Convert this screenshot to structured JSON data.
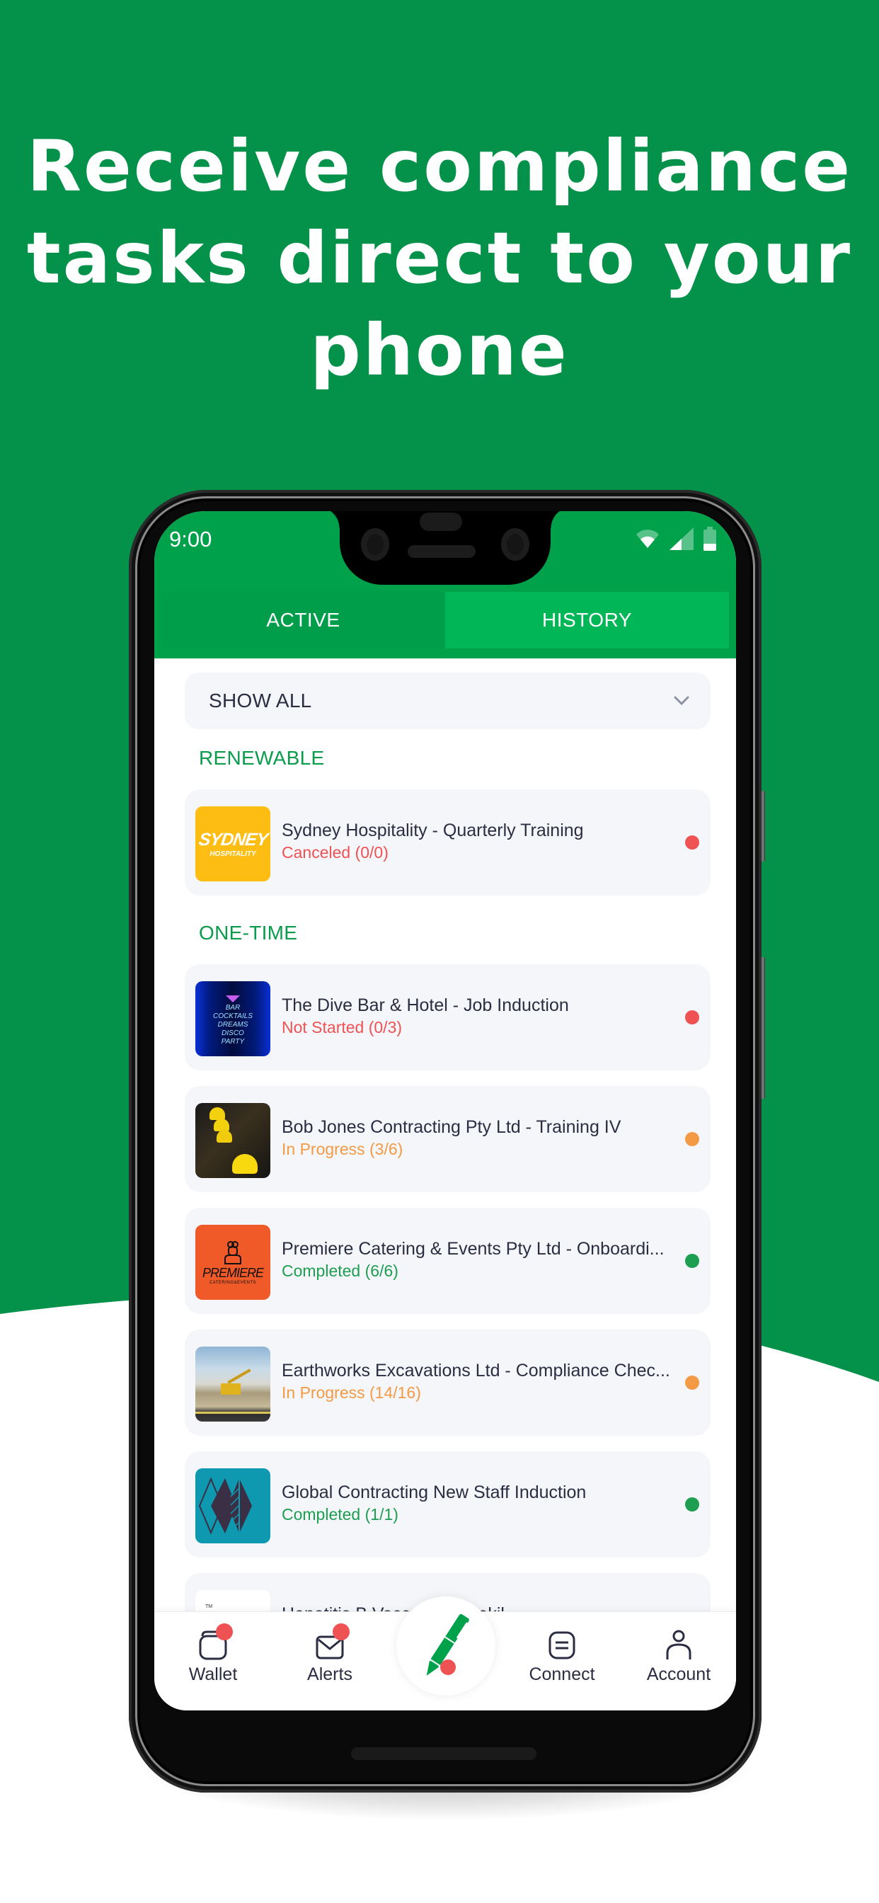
{
  "headline": {
    "lines": [
      "Receive compliance",
      "tasks direct to your",
      "phone"
    ]
  },
  "colors": {
    "brand_green": "#049149",
    "status_green": "#00A14B",
    "tab_active": "#009E4A",
    "tab_inactive": "#00B656",
    "section_green": "#0A9B4C",
    "red": "#EE5253",
    "orange": "#F39A45",
    "green_status": "#1E9E50",
    "text_dark": "#2B2D42"
  },
  "status_bar": {
    "time": "9:00",
    "icons": [
      "wifi-icon",
      "signal-icon",
      "battery-icon"
    ]
  },
  "tabs": [
    {
      "label": "ACTIVE",
      "selected": true
    },
    {
      "label": "HISTORY",
      "selected": false
    }
  ],
  "filter": {
    "selected": "SHOW ALL",
    "icon": "chevron-down-icon"
  },
  "sections": [
    {
      "label": "RENEWABLE",
      "items": [
        {
          "title": "Sydney Hospitality - Quarterly Training",
          "status": "Canceled (0/0)",
          "status_type": "red",
          "thumb": "sydney-hospitality-logo",
          "thumb_text": [
            "SYDNEY",
            "HOSPITALITY"
          ]
        }
      ]
    },
    {
      "label": "ONE-TIME",
      "items": [
        {
          "title": "The Dive Bar & Hotel - Job Induction",
          "status": "Not Started (0/3)",
          "status_type": "red",
          "thumb": "neon-bar-sign-photo",
          "thumb_text": [
            "BAR",
            "COCKTAILS",
            "DREAMS",
            "DISCO",
            "PARTY"
          ]
        },
        {
          "title": "Bob Jones Contracting Pty Ltd - Training IV",
          "status": "In Progress (3/6)",
          "status_type": "orange",
          "thumb": "hard-hats-photo"
        },
        {
          "title": "Premiere Catering & Events Pty Ltd - Onboardi...",
          "status": "Completed (6/6)",
          "status_type": "green",
          "thumb": "premiere-catering-logo",
          "thumb_text": [
            "PREMIERE",
            "CATERING&EVENTS"
          ]
        },
        {
          "title": "Earthworks Excavations Ltd - Compliance Chec...",
          "status": "In Progress (14/16)",
          "status_type": "orange",
          "thumb": "excavator-photo"
        },
        {
          "title": "Global Contracting New Staff Induction",
          "status": "Completed (1/1)",
          "status_type": "green",
          "thumb": "global-contracting-logo"
        },
        {
          "title": "Hepatitis B Vacc... - Rentokil",
          "status": "",
          "status_type": "",
          "thumb": "tm-logo",
          "thumb_text": [
            "TM"
          ],
          "partially_hidden": true
        }
      ]
    }
  ],
  "bottom_nav": [
    {
      "label": "Wallet",
      "icon": "wallet-icon",
      "badge": true
    },
    {
      "label": "Alerts",
      "icon": "mail-icon",
      "badge": true
    },
    {
      "label": "",
      "icon": "pen-icon",
      "badge": true,
      "center": true
    },
    {
      "label": "Connect",
      "icon": "chat-icon",
      "badge": false
    },
    {
      "label": "Account",
      "icon": "user-icon",
      "badge": false
    }
  ]
}
